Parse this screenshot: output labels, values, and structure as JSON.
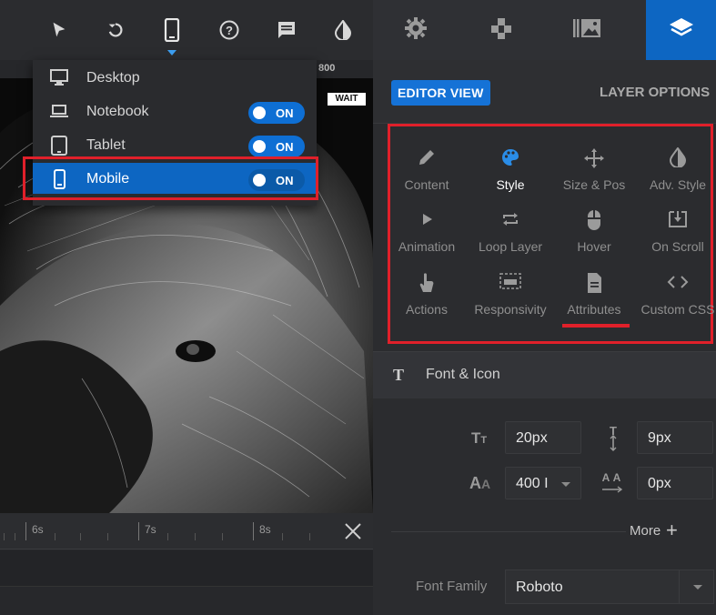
{
  "toolbar": {
    "icons": [
      "pointer-icon",
      "undo-icon",
      "mobile-device-icon",
      "help-icon",
      "comment-icon",
      "contrast-icon"
    ]
  },
  "canvas": {
    "ruler_label": "800"
  },
  "device_menu": {
    "items": [
      {
        "label": "Desktop",
        "icon": "desktop-icon",
        "toggle": null
      },
      {
        "label": "Notebook",
        "icon": "laptop-icon",
        "toggle": "ON"
      },
      {
        "label": "Tablet",
        "icon": "tablet-icon",
        "toggle": "ON"
      },
      {
        "label": "Mobile",
        "icon": "mobile-icon",
        "toggle": "ON",
        "active": true
      }
    ]
  },
  "timeline": {
    "ticks": [
      "6s",
      "7s",
      "8s"
    ],
    "wait_label": "WAIT"
  },
  "right_tabs": [
    "settings-icon",
    "puzzle-icon",
    "slides-icon",
    "layers-icon"
  ],
  "editor_view": {
    "button_label": "EDITOR VIEW",
    "layer_options_label": "LAYER OPTIONS"
  },
  "layer_options": [
    {
      "label": "Content",
      "icon": "pencil-icon"
    },
    {
      "label": "Style",
      "icon": "palette-icon",
      "active": true
    },
    {
      "label": "Size & Pos",
      "icon": "move-icon"
    },
    {
      "label": "Adv. Style",
      "icon": "contrast-icon"
    },
    {
      "label": "Animation",
      "icon": "play-icon"
    },
    {
      "label": "Loop Layer",
      "icon": "loop-icon"
    },
    {
      "label": "Hover",
      "icon": "mouse-icon"
    },
    {
      "label": "On Scroll",
      "icon": "scroll-icon"
    },
    {
      "label": "Actions",
      "icon": "hand-icon"
    },
    {
      "label": "Responsivity",
      "icon": "responsive-icon"
    },
    {
      "label": "Attributes",
      "icon": "file-icon"
    },
    {
      "label": "Custom CSS",
      "icon": "code-icon"
    }
  ],
  "font_icon": {
    "title": "Font & Icon",
    "font_size": "20px",
    "line_height": "9px",
    "font_weight": "400 I",
    "letter_spacing": "0px",
    "more_label": "More",
    "font_family_label": "Font Family",
    "font_family": "Roboto"
  },
  "colors": {
    "accent": "#0d66c2",
    "highlight": "#e0202a",
    "panel": "#2b2c2f"
  }
}
